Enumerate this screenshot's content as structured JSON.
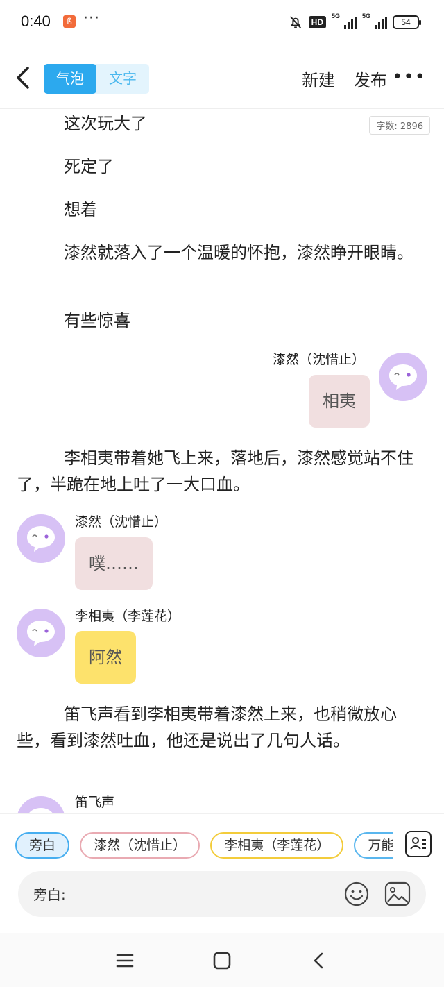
{
  "status_bar": {
    "time": "0:40",
    "app_icon_glyph": "ß",
    "dots": "···",
    "hd_label": "HD",
    "signal1_label": "5G",
    "signal2_label": "5G",
    "battery": "54"
  },
  "nav": {
    "mode_tabs": [
      "气泡",
      "文字"
    ],
    "active_mode": "气泡",
    "new_label": "新建",
    "publish_label": "发布"
  },
  "content": {
    "word_count": "字数: 2896",
    "paragraphs": [
      "这次玩大了",
      "死定了",
      "想着",
      "漆然就落入了一个温暖的怀抱，漆然睁开眼睛。",
      "有些惊喜",
      "李相夷带着她飞上来，落地后，漆然感觉站不住了，半跪在地上吐了一大口血。",
      "笛飞声看到李相夷带着漆然上来，也稍微放心些，看到漆然吐血，他还是说出了几句人话。"
    ],
    "messages": [
      {
        "speaker": "漆然（沈惜止）",
        "text": "相夷",
        "side": "right",
        "color": "#f1dfe0"
      },
      {
        "speaker": "漆然（沈惜止）",
        "text": "噗……",
        "side": "left",
        "color": "#f1dfe0"
      },
      {
        "speaker": "李相夷（李莲花）",
        "text": "阿然",
        "side": "left",
        "color": "#fde26c"
      },
      {
        "speaker": "笛飞声",
        "text": "",
        "side": "left",
        "color": "#ffffff"
      }
    ]
  },
  "bottom": {
    "roles": [
      "旁白",
      "漆然（沈惜止）",
      "李相夷（李莲花）",
      "万能龙套"
    ],
    "selected_role": "旁白",
    "input_label": "旁白:"
  },
  "colors": {
    "accent": "#2ca9ee",
    "avatar": "#d7c1f5",
    "bubble_pink": "#f1dfe0",
    "bubble_yellow": "#fde26c"
  },
  "icons": [
    "back-icon",
    "more-icon",
    "mute-bell-icon",
    "avatar-face-icon",
    "role-manage-icon",
    "emoji-icon",
    "image-icon",
    "menu-icon",
    "home-icon",
    "back-nav-icon"
  ]
}
